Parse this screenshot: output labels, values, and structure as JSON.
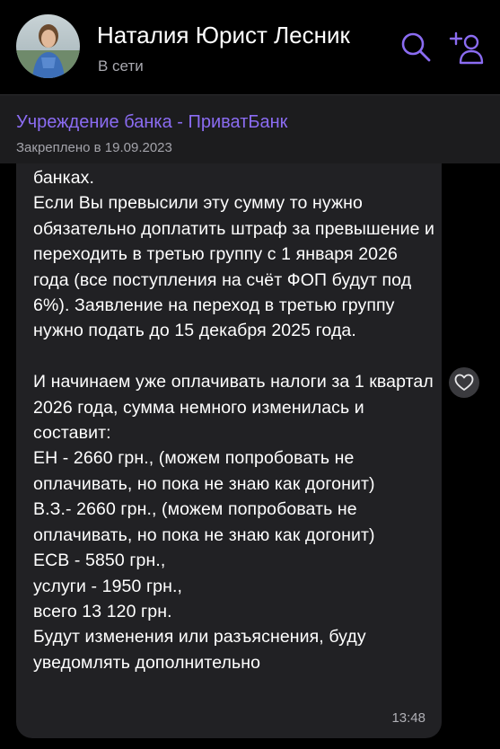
{
  "header": {
    "contact_name": "Наталия Юрист Лесник",
    "status": "В сети",
    "avatar_icon": "avatar-photo",
    "search_icon": "search-icon",
    "add_contact_icon": "add-person-icon"
  },
  "pinned": {
    "title": "Учреждение банка - ПриватБанк",
    "date": "Закреплено в 19.09.2023"
  },
  "message": {
    "text": "банках.\nЕсли Вы превысили эту сумму то нужно обязательно доплатить штраф за превышение и переходить в третью группу с 1 января 2026 года (все поступления на счёт ФОП будут под 6%). Заявление на переход в третью группу нужно подать до 15 декабря 2025 года.\n\nИ начинаем уже оплачивать налоги за 1 квартал 2026 года, сумма немного изменилась и составит:\nЕН - 2660 грн., (можем попробовать не оплачивать, но пока не знаю как догонит)\nВ.З.- 2660 грн., (можем попробовать не оплачивать, но пока не знаю как догонит)\nЕСВ - 5850 грн.,\nуслуги - 1950 грн.,\nвсего 13 120 грн.\nБудут изменения или разъяснения, буду уведомлять дополнительно",
    "time": "13:48",
    "reaction_icon": "heart-icon"
  },
  "colors": {
    "accent": "#8b6cf2",
    "background": "#000000",
    "bubble": "#212124",
    "pinned_bar": "#1c1c1e"
  }
}
